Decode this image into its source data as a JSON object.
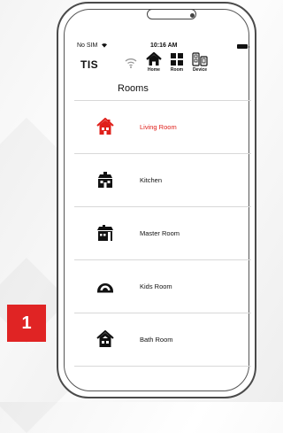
{
  "status": {
    "carrier": "No SIM",
    "time": "10:16 AM"
  },
  "logo": "TIS",
  "nav": {
    "home": "Home",
    "room": "Room",
    "device": "Device"
  },
  "page_title": "Rooms",
  "rooms": [
    {
      "label": "Living Room",
      "icon": "house-icon",
      "active": true
    },
    {
      "label": "Kitchen",
      "icon": "kitchen-icon",
      "active": false
    },
    {
      "label": "Master Room",
      "icon": "master-room-icon",
      "active": false
    },
    {
      "label": "Kids Room",
      "icon": "kids-room-icon",
      "active": false
    },
    {
      "label": "Bath Room",
      "icon": "bath-room-icon",
      "active": false
    }
  ],
  "step_badge": "1",
  "colors": {
    "accent": "#e0201b",
    "badge": "#e02424"
  }
}
